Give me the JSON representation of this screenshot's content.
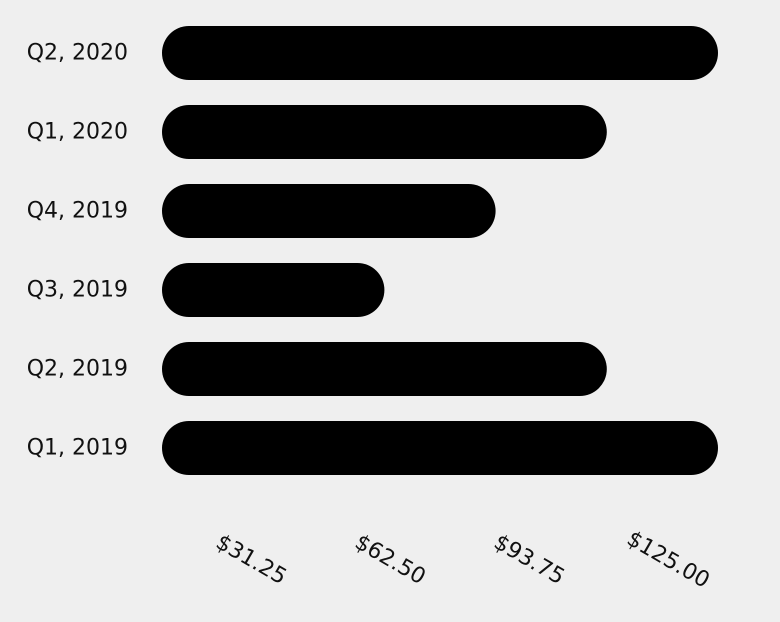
{
  "chart_data": {
    "type": "bar",
    "orientation": "horizontal",
    "categories": [
      "Q2, 2020",
      "Q1, 2020",
      "Q4, 2019",
      "Q3, 2019",
      "Q2, 2019",
      "Q1, 2019"
    ],
    "values": [
      125,
      100,
      75,
      50,
      100,
      125
    ],
    "xlim": [
      0,
      125
    ],
    "xticks": [
      31.25,
      62.5,
      93.75,
      125
    ],
    "xtick_labels": [
      "$31.25",
      "$62.50",
      "$93.75",
      "$125.00"
    ],
    "title": "",
    "xlabel": "",
    "ylabel": "",
    "bar_color": "#000000",
    "grid": false,
    "legend": "none"
  }
}
